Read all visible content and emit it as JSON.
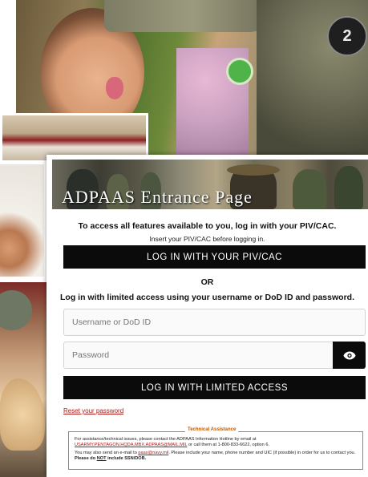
{
  "banner": {
    "title": "ADPAAS Entrance Page"
  },
  "patch_text": "2",
  "intro": {
    "lead": "To access all features available to you, log in with your PIV/CAC.",
    "hint": "Insert your PIV/CAC before logging in."
  },
  "buttons": {
    "piv_login": "LOG IN WITH YOUR PIV/CAC",
    "limited_login": "LOG IN WITH LIMITED ACCESS"
  },
  "divider": {
    "or": "OR"
  },
  "limited": {
    "text": "Log in with limited access using your username or DoD ID and password."
  },
  "fields": {
    "username_placeholder": "Username or DoD ID",
    "password_placeholder": "Password"
  },
  "icons": {
    "password_toggle": "eye-icon"
  },
  "links": {
    "reset_password": "Reset your password"
  },
  "assistance": {
    "legend": "Technical Assistance",
    "line1_pre": "For assistance/technical issues, please contact the ADPAAS Information Hotline by email at",
    "line1_email": "USARMY.PENTAGON.HQDA.MBX.ADPAAS@MAIL.MIL",
    "line1_post": "or call them at 1-800-833-6622, option 6.",
    "line2_pre": "You may also send an e-mail to",
    "line2_email": "paas@navy.mil",
    "line2_mid": ". Please include your name, phone number and UIC (if possible) in order for us to contact you.",
    "line2_please": "Please do",
    "line2_not": "NOT",
    "line2_end": "include SSN/DOB."
  },
  "colors": {
    "button_bg": "#0b0b0b",
    "link_red": "#b01818",
    "assist_legend": "#c35a00"
  }
}
